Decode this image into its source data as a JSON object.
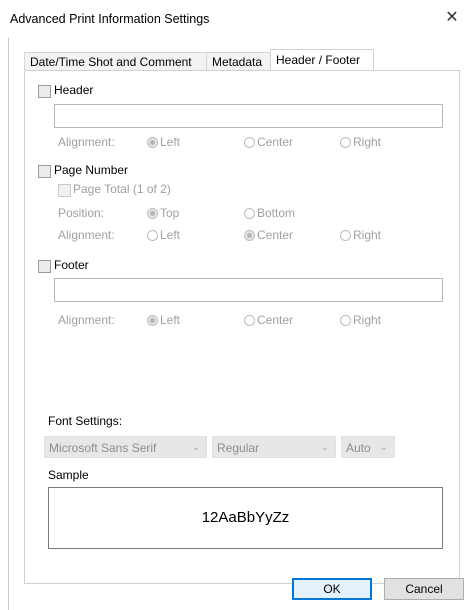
{
  "window": {
    "title": "Advanced Print Information Settings",
    "close_symbol": "✕"
  },
  "tabs": [
    {
      "label": "Date/Time Shot and Comment",
      "active": false
    },
    {
      "label": "Metadata",
      "active": false
    },
    {
      "label": "Header / Footer",
      "active": true
    }
  ],
  "header": {
    "label": "Header",
    "checked": false,
    "text_value": "",
    "alignment_label": "Alignment:",
    "alignment_options": [
      "Left",
      "Center",
      "Right"
    ],
    "alignment_selected": "Left"
  },
  "page_number": {
    "label": "Page Number",
    "checked": false,
    "page_total_label": "Page Total (1 of 2)",
    "position_label": "Position:",
    "position_options": [
      "Top",
      "Bottom"
    ],
    "position_selected": "Top",
    "alignment_label": "Alignment:",
    "alignment_options": [
      "Left",
      "Center",
      "Right"
    ],
    "alignment_selected": "Center"
  },
  "footer": {
    "label": "Footer",
    "checked": false,
    "text_value": "",
    "alignment_label": "Alignment:",
    "alignment_options": [
      "Left",
      "Center",
      "Right"
    ],
    "alignment_selected": "Left"
  },
  "font_settings": {
    "label": "Font Settings:",
    "font_family": "Microsoft Sans Serif",
    "font_style": "Regular",
    "font_size": "Auto"
  },
  "sample": {
    "label": "Sample",
    "text": "12AaBbYyZz"
  },
  "buttons": {
    "ok": "OK",
    "cancel": "Cancel"
  },
  "colors": {
    "accent": "#0078d7",
    "disabled_text": "#a0a0a0"
  }
}
